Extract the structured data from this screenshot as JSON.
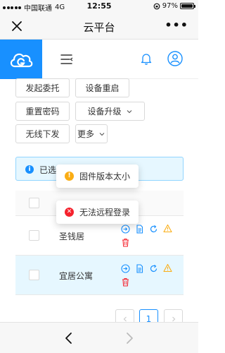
{
  "status_bar": {
    "carrier": "中国联通",
    "network": "4G",
    "time": "12:55",
    "battery": "97%",
    "battery_level": 0.97
  },
  "nav_bar": {
    "title": "云平台"
  },
  "toolbar": {
    "buttons": [
      {
        "label": "发起委托"
      },
      {
        "label": "设备重启"
      },
      {
        "label": "重置密码"
      },
      {
        "label": "设备升级"
      },
      {
        "label": "无线下发"
      },
      {
        "label": "更多"
      }
    ]
  },
  "alert": {
    "text": "已选"
  },
  "toasts": [
    {
      "type": "warning",
      "text": "固件版本太小"
    },
    {
      "type": "error",
      "text": "无法远程登录"
    }
  ],
  "table": {
    "rows": [
      {
        "name": "圣钱居",
        "selected": false
      },
      {
        "name": "宜居公寓",
        "selected": true
      }
    ]
  },
  "pagination": {
    "current": "1"
  },
  "colors": {
    "primary": "#1890ff",
    "warning": "#faad14",
    "error": "#f5222d",
    "selected_row": "#e6f7ff"
  }
}
